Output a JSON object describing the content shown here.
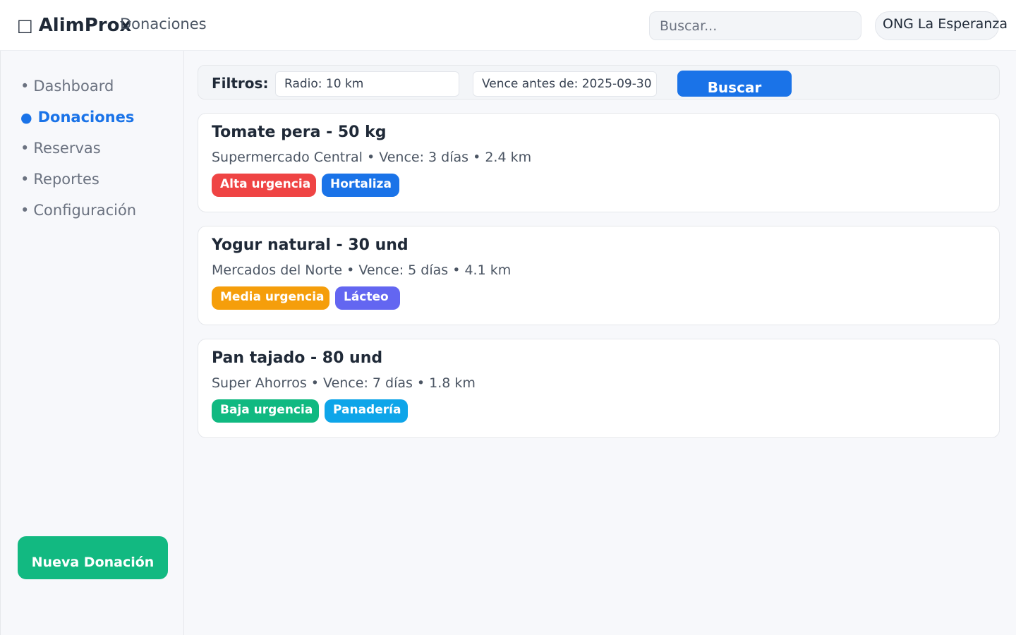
{
  "app": {
    "name": "AlimProx",
    "logo_icon": "□",
    "section": "Donaciones"
  },
  "header": {
    "search_placeholder": "Buscar...",
    "organization": "ONG La Esperanza"
  },
  "sidebar": {
    "items": [
      {
        "label": "Dashboard",
        "bullet": "•",
        "active": false
      },
      {
        "label": "Donaciones",
        "bullet": "●",
        "active": true
      },
      {
        "label": "Reservas",
        "bullet": "•",
        "active": false
      },
      {
        "label": "Reportes",
        "bullet": "•",
        "active": false
      },
      {
        "label": "Configuración",
        "bullet": "•",
        "active": false
      }
    ],
    "new_button": "Nueva Donación"
  },
  "filters": {
    "label": "Filtros:",
    "radius": "Radio: 10 km",
    "expiry": "Vence antes de: 2025-09-30",
    "search_button": "Buscar"
  },
  "donations": [
    {
      "title": "Tomate pera - 50 kg",
      "meta": "Supermercado Central • Vence: 3 días • 2.4 km",
      "urgency": "Alta urgencia",
      "urgency_color": "#ef4444",
      "category": "Hortaliza",
      "category_color": "#1a73e8"
    },
    {
      "title": "Yogur natural - 30 und",
      "meta": "Mercados del Norte • Vence: 5 días • 4.1 km",
      "urgency": "Media urgencia",
      "urgency_color": "#f59e0b",
      "category": "Lácteo",
      "category_color": "#6366f1"
    },
    {
      "title": "Pan tajado - 80 und",
      "meta": "Super Ahorros • Vence: 7 días • 1.8 km",
      "urgency": "Baja urgencia",
      "urgency_color": "#10b981",
      "category": "Panadería",
      "category_color": "#0ea5e9"
    }
  ],
  "colors": {
    "primary": "#1a73e8",
    "success": "#12b981"
  }
}
